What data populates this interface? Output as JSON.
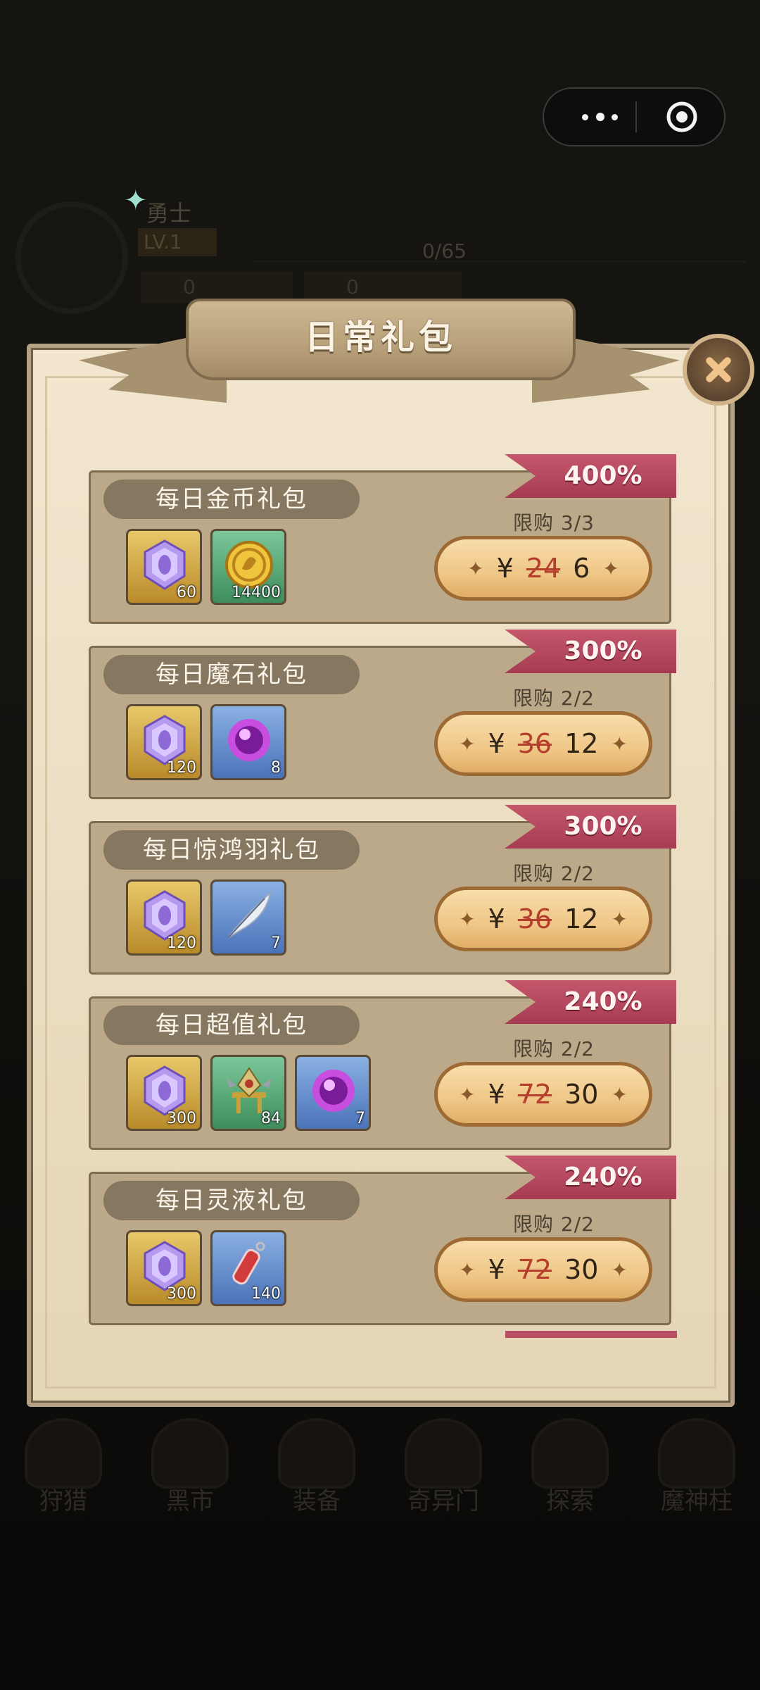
{
  "capsule": {
    "more_label": "•••",
    "close_label": "◎"
  },
  "hud": {
    "name": "勇士",
    "level": "LV.1",
    "exp": "0/65",
    "coins": "0",
    "gems": "0"
  },
  "title": "日常礼包",
  "packs": [
    {
      "name": "每日金币礼包",
      "bonus": "400%",
      "limit": "限购 3/3",
      "currency": "¥",
      "old_price": "24",
      "price": "6",
      "items": [
        {
          "type": "purple-crystal",
          "qty": "60",
          "frame": "gold"
        },
        {
          "type": "gold-coin",
          "qty": "14400",
          "frame": "green"
        }
      ]
    },
    {
      "name": "每日魔石礼包",
      "bonus": "300%",
      "limit": "限购 2/2",
      "currency": "¥",
      "old_price": "36",
      "price": "12",
      "items": [
        {
          "type": "purple-crystal",
          "qty": "120",
          "frame": "gold"
        },
        {
          "type": "magic-stone",
          "qty": "8",
          "frame": "blue"
        }
      ]
    },
    {
      "name": "每日惊鸿羽礼包",
      "bonus": "300%",
      "limit": "限购 2/2",
      "currency": "¥",
      "old_price": "36",
      "price": "12",
      "items": [
        {
          "type": "purple-crystal",
          "qty": "120",
          "frame": "gold"
        },
        {
          "type": "feather",
          "qty": "7",
          "frame": "blue"
        }
      ]
    },
    {
      "name": "每日超值礼包",
      "bonus": "240%",
      "limit": "限购 2/2",
      "currency": "¥",
      "old_price": "72",
      "price": "30",
      "items": [
        {
          "type": "purple-crystal",
          "qty": "300",
          "frame": "gold"
        },
        {
          "type": "totem",
          "qty": "84",
          "frame": "green"
        },
        {
          "type": "magic-stone",
          "qty": "7",
          "frame": "blue"
        }
      ]
    },
    {
      "name": "每日灵液礼包",
      "bonus": "240%",
      "limit": "限购 2/2",
      "currency": "¥",
      "old_price": "72",
      "price": "30",
      "items": [
        {
          "type": "purple-crystal",
          "qty": "300",
          "frame": "gold"
        },
        {
          "type": "potion",
          "qty": "140",
          "frame": "blue"
        }
      ]
    }
  ],
  "bottom_nav": [
    "狩猎",
    "黑市",
    "装备",
    "奇异门",
    "探索",
    "魔神柱"
  ]
}
